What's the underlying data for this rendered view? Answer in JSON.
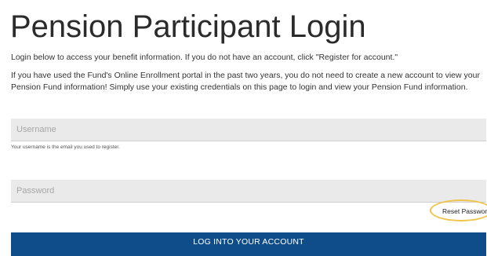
{
  "page": {
    "title": "Pension Participant Login",
    "intro": "Login below to access your benefit information. If you do not have an account, click \"Register for account.\"",
    "info": "If you have used the Fund's Online Enrollment portal in the past two years, you do not need to create a new account to view your Pension Fund information! Simply use your existing credentials on this page to login and view your Pension Fund information."
  },
  "form": {
    "username": {
      "placeholder": "Username",
      "value": "",
      "hint": "Your username is the email you used to register."
    },
    "password": {
      "placeholder": "Password",
      "value": ""
    },
    "reset_password_label": "Reset Password",
    "login_button_label": "LOG INTO YOUR ACCOUNT"
  },
  "colors": {
    "button_background": "#0f4d8a",
    "field_background": "#eaeaea",
    "highlight_ring": "#f0c44a"
  }
}
